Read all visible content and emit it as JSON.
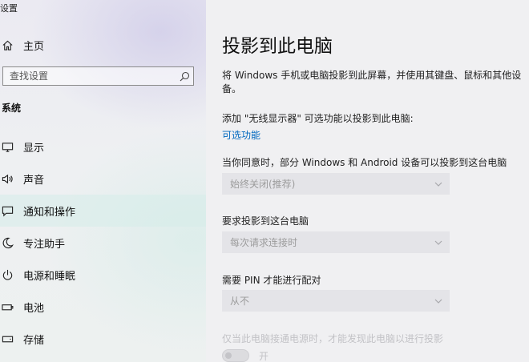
{
  "window": {
    "title": "设置"
  },
  "sidebar": {
    "home_label": "主页",
    "search_placeholder": "查找设置",
    "section_label": "系统",
    "items": [
      {
        "label": "显示",
        "icon": "monitor-icon"
      },
      {
        "label": "声音",
        "icon": "speaker-icon"
      },
      {
        "label": "通知和操作",
        "icon": "message-icon"
      },
      {
        "label": "专注助手",
        "icon": "moon-icon"
      },
      {
        "label": "电源和睡眠",
        "icon": "power-icon"
      },
      {
        "label": "电池",
        "icon": "battery-icon"
      },
      {
        "label": "存储",
        "icon": "storage-icon"
      }
    ],
    "active_item": "通知和操作"
  },
  "main": {
    "title": "投影到此电脑",
    "description": "将 Windows 手机或电脑投影到此屏幕，并使用其键盘、鼠标和其他设备。",
    "feature_note": "添加 \"无线显示器\" 可选功能以投影到此电脑:",
    "optional_features_link": "可选功能",
    "settings": [
      {
        "label": "当你同意时，部分 Windows 和 Android 设备可以投影到这台电脑",
        "value": "始终关闭(推荐)"
      },
      {
        "label": "要求投影到这台电脑",
        "value": "每次请求连接时"
      },
      {
        "label": "需要 PIN 才能进行配对",
        "value": "从不"
      }
    ],
    "power_note": "仅当此电脑接通电源时，才能发现此电脑以进行投影",
    "toggle_label": "开"
  },
  "colors": {
    "link": "#0068bf",
    "disabled": "#c2c2c6"
  }
}
